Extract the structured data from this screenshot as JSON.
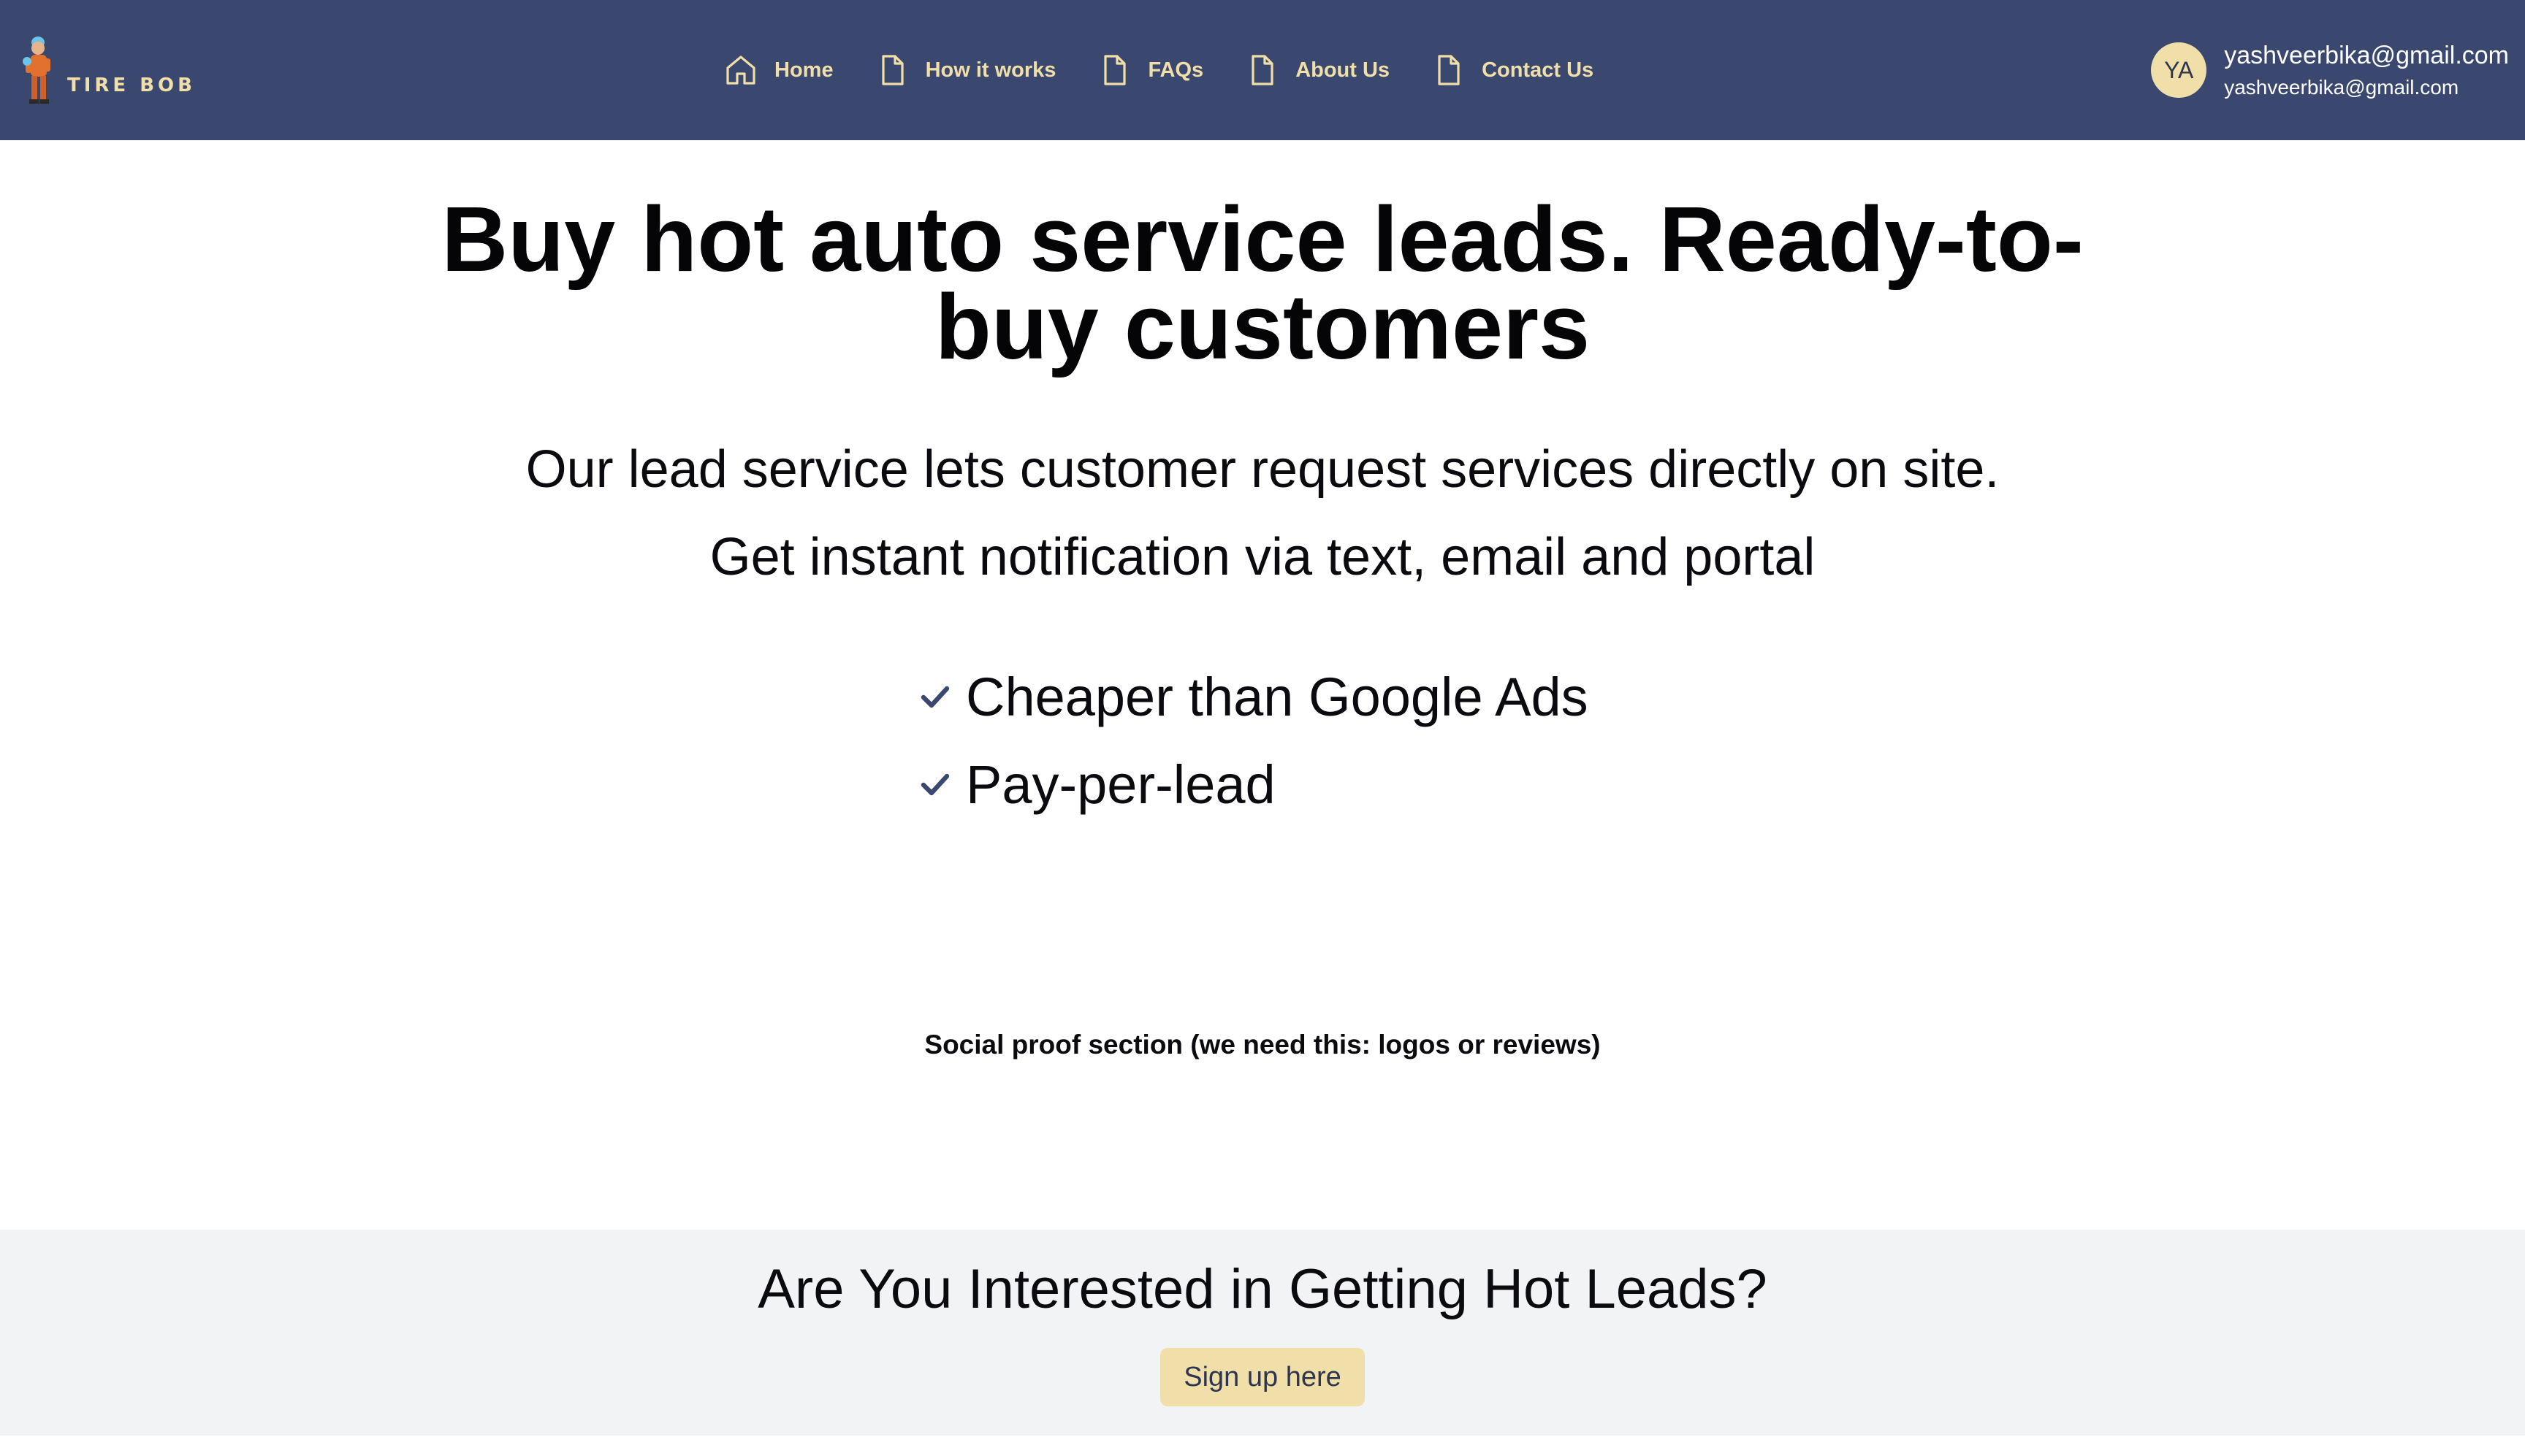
{
  "brand": {
    "name": "TIRE BOB",
    "icon": "mascot-logo-icon"
  },
  "nav": [
    {
      "label": "Home",
      "icon": "home-icon"
    },
    {
      "label": "How it works",
      "icon": "document-icon"
    },
    {
      "label": "FAQs",
      "icon": "document-icon"
    },
    {
      "label": "About Us",
      "icon": "document-icon"
    },
    {
      "label": "Contact Us",
      "icon": "document-icon"
    }
  ],
  "user": {
    "initials": "YA",
    "name": "yashveerbika@gmail.com",
    "email": "yashveerbika@gmail.com"
  },
  "hero": {
    "title": "Buy hot auto service leads. Ready-to-buy customers",
    "subtitle_line1": "Our lead service lets customer request services directly on site.",
    "subtitle_line2": "Get instant notification via text, email and portal",
    "bullets": [
      "Cheaper than Google Ads",
      "Pay-per-lead"
    ],
    "bullet_icon": "checkmark-icon"
  },
  "social_proof": {
    "text": "Social proof section (we need this: logos or reviews)"
  },
  "cta": {
    "title": "Are You Interested in Getting Hot Leads?",
    "button_label": "Sign up here"
  },
  "colors": {
    "header_bg": "#3a4870",
    "accent": "#f0dfa8",
    "cta_bg": "#f2f3f5",
    "text_dark": "#2d3550"
  }
}
